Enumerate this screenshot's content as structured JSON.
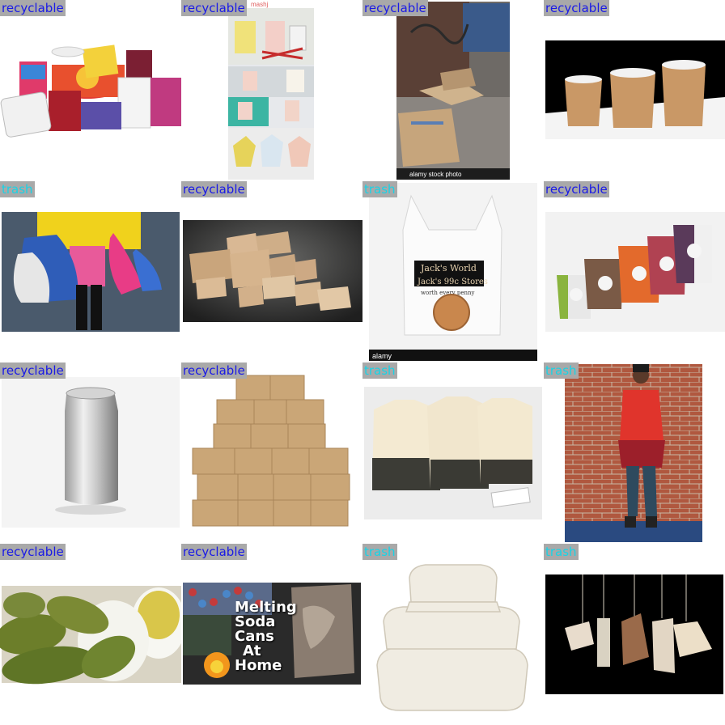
{
  "grid": {
    "cells": [
      {
        "label": "recyclable",
        "class": "recyclable",
        "subject": "paper-cups"
      },
      {
        "label": "recyclable",
        "class": "recyclable",
        "subject": "paper-cup-crafts",
        "watermark": "mashj"
      },
      {
        "label": "recyclable",
        "class": "recyclable",
        "subject": "cardboard-alley",
        "watermark": "alamy stock photo"
      },
      {
        "label": "recyclable",
        "class": "recyclable",
        "subject": "kraft-cups"
      },
      {
        "label": "trash",
        "class": "trash",
        "subject": "plastic-bags-shopper"
      },
      {
        "label": "recyclable",
        "class": "recyclable",
        "subject": "cardboard-boxes-pile"
      },
      {
        "label": "trash",
        "class": "trash",
        "subject": "plastic-bag-penny",
        "bag_text_1": "Jack's World",
        "bag_text_2": "Jack's 99c Stores",
        "bag_text_3": "worth every penny",
        "watermark": "alamy"
      },
      {
        "label": "recyclable",
        "class": "recyclable",
        "subject": "coffee-cups"
      },
      {
        "label": "recyclable",
        "class": "recyclable",
        "subject": "aluminum-can"
      },
      {
        "label": "recyclable",
        "class": "recyclable",
        "subject": "box-pyramid"
      },
      {
        "label": "trash",
        "class": "trash",
        "subject": "tea-bags"
      },
      {
        "label": "trash",
        "class": "trash",
        "subject": "person-brick-wall"
      },
      {
        "label": "recyclable",
        "class": "recyclable",
        "subject": "pickles"
      },
      {
        "label": "recyclable",
        "class": "recyclable",
        "subject": "melting-soda-cans",
        "sign_lines": [
          "Melting",
          "Soda",
          "Cans",
          "At",
          "Home"
        ]
      },
      {
        "label": "trash",
        "class": "trash",
        "subject": "takeout-containers"
      },
      {
        "label": "trash",
        "class": "trash",
        "subject": "hanging-tea-bags"
      }
    ]
  }
}
